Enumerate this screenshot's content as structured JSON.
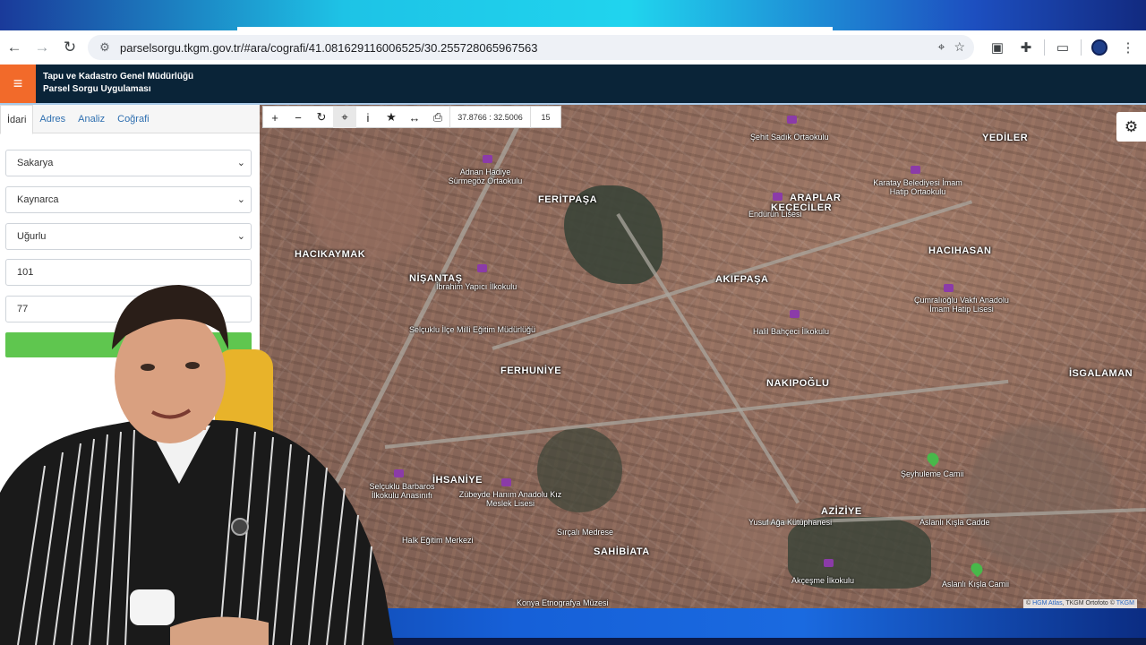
{
  "browser": {
    "url": "parselsorgu.tkgm.gov.tr/#ara/cografi/41.081629116006525/30.255728065967563"
  },
  "app": {
    "title_line1": "Tapu ve Kadastro Genel Müdürlüğü",
    "title_line2": "Parsel Sorgu Uygulaması"
  },
  "tabs": [
    {
      "label": "İdari"
    },
    {
      "label": "Adres"
    },
    {
      "label": "Analiz"
    },
    {
      "label": "Coğrafi"
    }
  ],
  "form": {
    "il": "Sakarya",
    "ilce": "Kaynarca",
    "mahalle": "Uğurlu",
    "ada": "101",
    "parsel": "77"
  },
  "toolbar": {
    "coords": "37.8766 : 32.5006",
    "zoom": "15"
  },
  "map": {
    "districts": [
      {
        "name": "YEDİLER"
      },
      {
        "name": "FERİTPAŞA"
      },
      {
        "name": "ARAPLAR"
      },
      {
        "name": "KEÇECİLER"
      },
      {
        "name": "HACIKAYMAK"
      },
      {
        "name": "HACIHASAN"
      },
      {
        "name": "NİŞANTAŞ"
      },
      {
        "name": "AKIFPAŞA"
      },
      {
        "name": "FERHUNİYE"
      },
      {
        "name": "NAKIPOĞLU"
      },
      {
        "name": "İSGALAMAN"
      },
      {
        "name": "İHSANİYE"
      },
      {
        "name": "AZİZİYE"
      },
      {
        "name": "SAHİBİATA"
      }
    ],
    "pois": [
      {
        "name": "Şehit Sadık Ortaokulu"
      },
      {
        "name": "Adnan Hadiye Sürmegöz Ortaokulu"
      },
      {
        "name": "Karatay Belediyesi İmam Hatip Ortaokulu"
      },
      {
        "name": "Endürün Lisesi"
      },
      {
        "name": "İbrahim Yapıcı İlkokulu"
      },
      {
        "name": "Çumralıoğlu Vakfı Anadolu İmam Hatip Lisesi"
      },
      {
        "name": "Halil Bahçeci İlkokulu"
      },
      {
        "name": "Selçuklu İlçe Milli Eğitim Müdürlüğü"
      },
      {
        "name": "Şeyhuleme Camii"
      },
      {
        "name": "Selçuklu Barbaros İlkokulu Anasınıfı"
      },
      {
        "name": "Zübeyde Hanım Anadolu Kız Meslek Lisesi"
      },
      {
        "name": "Sırçalı Medrese"
      },
      {
        "name": "Yusuf Ağa Kütüphanesi"
      },
      {
        "name": "Aslanlı Kışla Cadde"
      },
      {
        "name": "Halk Eğitim Merkezi"
      },
      {
        "name": "Akçeşme İlkokulu"
      },
      {
        "name": "Aslanlı Kışla Camii"
      },
      {
        "name": "Konya Etnografya Müzesi"
      }
    ],
    "attribution_prefix": "©",
    "attribution_hgm": "HGM Atlas",
    "attribution_mid": ", TKGM Ortofoto ©",
    "attribution_tkgm": "TKGM"
  }
}
